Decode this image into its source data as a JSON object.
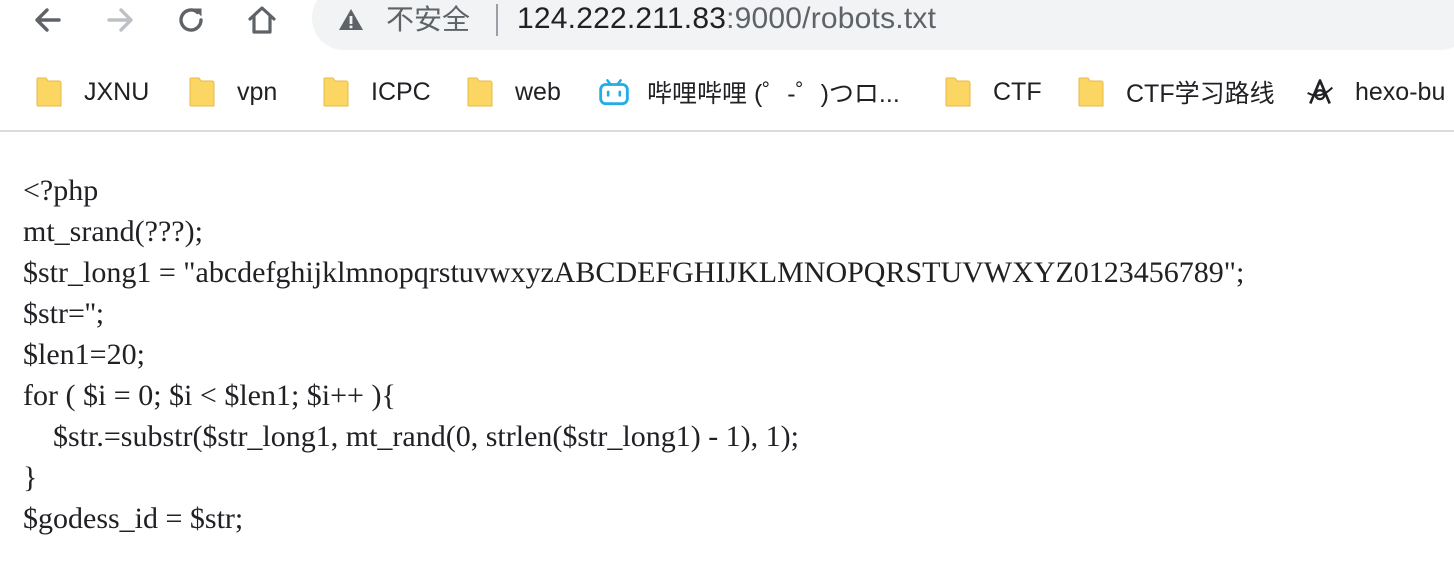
{
  "browser": {
    "nav": {
      "back": "back-arrow",
      "forward": "forward-arrow",
      "reload": "reload",
      "home": "home"
    },
    "address_bar": {
      "security_label": "不安全",
      "url_host": "124.222.211.83",
      "url_rest": ":9000/robots.txt"
    },
    "bookmarks": [
      {
        "label": "JXNU",
        "icon": "folder-icon"
      },
      {
        "label": "vpn",
        "icon": "folder-icon"
      },
      {
        "label": "ICPC",
        "icon": "folder-icon"
      },
      {
        "label": "web",
        "icon": "folder-icon"
      },
      {
        "label": "哔哩哔哩 (゜-゜)つロ...",
        "icon": "bilibili-icon"
      },
      {
        "label": "CTF",
        "icon": "folder-icon"
      },
      {
        "label": "CTF学习路线",
        "icon": "folder-icon"
      },
      {
        "label": "hexo-bu",
        "icon": "hexo-icon"
      }
    ],
    "colors": {
      "folder": "#fcd663",
      "folder_dark": "#f2c14d",
      "bilibili": "#23ade5",
      "omnibox_bg": "#f1f3f4",
      "text": "#202124"
    }
  },
  "page": {
    "lines": [
      "<?php",
      "mt_srand(???);",
      "$str_long1 = \"abcdefghijklmnopqrstuvwxyzABCDEFGHIJKLMNOPQRSTUVWXYZ0123456789\";",
      "$str='';",
      "$len1=20;",
      "for ( $i = 0; $i < $len1; $i++ ){",
      "    $str.=substr($str_long1, mt_rand(0, strlen($str_long1) - 1), 1);",
      "}",
      "$godess_id = $str;"
    ]
  }
}
